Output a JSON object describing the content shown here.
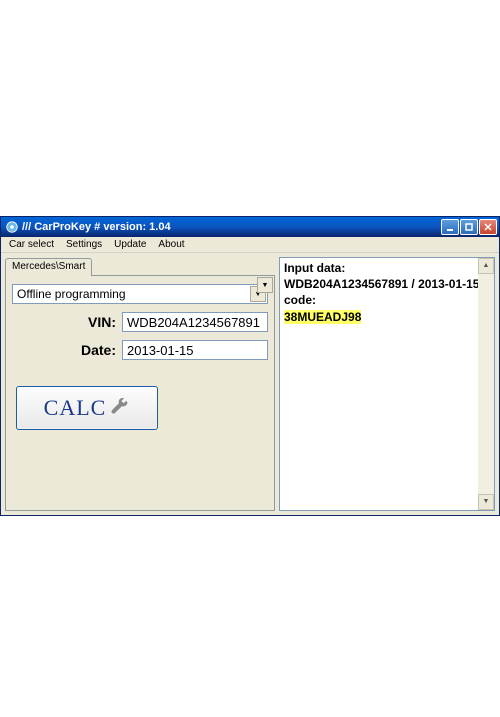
{
  "window": {
    "title": "/// CarProKey # version: 1.04"
  },
  "menu": {
    "car_select": "Car select",
    "settings": "Settings",
    "update": "Update",
    "about": "About"
  },
  "tab": {
    "label": "Mercedes\\Smart"
  },
  "form": {
    "mode_value": "Offline programming",
    "vin_label": "VIN:",
    "vin_value": "WDB204A1234567891",
    "date_label": "Date:",
    "date_value": "2013-01-15",
    "calc_label": "CALC"
  },
  "output": {
    "line1": "Input data:",
    "line2": "WDB204A1234567891 / 2013-01-15",
    "line3": "code:",
    "line4": "38MUEADJ98"
  }
}
